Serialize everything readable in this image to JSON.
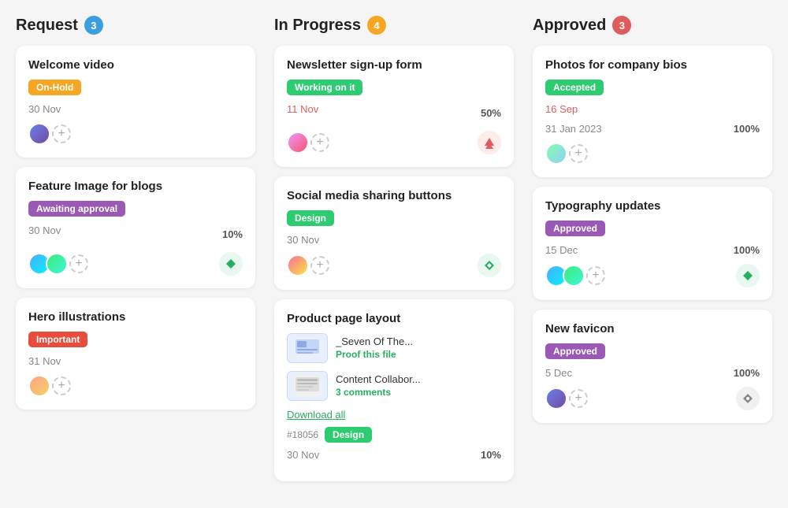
{
  "columns": [
    {
      "id": "request",
      "title": "Request",
      "badge": "3",
      "badge_class": "badge-blue",
      "cards": [
        {
          "id": "card-welcome",
          "title": "Welcome video",
          "tag": "On-Hold",
          "tag_class": "tag-on-hold",
          "date": "30 Nov",
          "date_red": false,
          "show_percent": false,
          "percent": "",
          "avatars": [
            "av1"
          ],
          "show_icon": false,
          "icon_type": ""
        },
        {
          "id": "card-feature",
          "title": "Feature Image for blogs",
          "tag": "Awaiting approval",
          "tag_class": "tag-awaiting",
          "date": "30 Nov",
          "date_red": false,
          "show_percent": true,
          "percent": "10%",
          "avatars": [
            "av3",
            "av4"
          ],
          "show_icon": true,
          "icon_type": "diamond-green"
        },
        {
          "id": "card-hero",
          "title": "Hero illustrations",
          "tag": "Important",
          "tag_class": "tag-important",
          "date": "31 Nov",
          "date_red": false,
          "show_percent": false,
          "percent": "",
          "avatars": [
            "av7"
          ],
          "show_icon": false,
          "icon_type": ""
        }
      ]
    },
    {
      "id": "in-progress",
      "title": "In Progress",
      "badge": "4",
      "badge_class": "badge-yellow",
      "cards": [
        {
          "id": "card-newsletter",
          "title": "Newsletter sign-up form",
          "tag": "Working on it",
          "tag_class": "tag-working",
          "date": "11 Nov",
          "date_red": true,
          "show_percent": true,
          "percent": "50%",
          "avatars": [
            "av2"
          ],
          "show_icon": true,
          "icon_type": "arrow-red"
        },
        {
          "id": "card-social",
          "title": "Social media sharing buttons",
          "tag": "Design",
          "tag_class": "tag-design",
          "date": "30 Nov",
          "date_red": false,
          "show_percent": false,
          "percent": "",
          "avatars": [
            "av5"
          ],
          "show_icon": true,
          "icon_type": "diamond-green"
        },
        {
          "id": "card-product",
          "title": "Product page layout",
          "tag": "",
          "tag_class": "",
          "date": "30 Nov",
          "date_red": false,
          "show_percent": true,
          "percent": "10%",
          "avatars": [
            "av6"
          ],
          "show_icon": false,
          "icon_type": "",
          "has_files": true,
          "files": [
            {
              "name": "_Seven Of The...",
              "action": "Proof this file",
              "action_color": "green"
            },
            {
              "name": "Content Collabor...",
              "action": "3 comments",
              "action_color": "green"
            }
          ],
          "download_all": "Download all",
          "hash_id": "#18056",
          "tag2": "Design",
          "tag2_class": "tag-design"
        }
      ]
    },
    {
      "id": "approved",
      "title": "Approved",
      "badge": "3",
      "badge_class": "badge-red",
      "cards": [
        {
          "id": "card-photos",
          "title": "Photos for company bios",
          "tag": "Accepted",
          "tag_class": "tag-accepted",
          "date": "16 Sep",
          "date_red": true,
          "date2": "31 Jan 2023",
          "show_percent": true,
          "percent": "100%",
          "avatars": [
            "av8"
          ],
          "show_icon": false,
          "icon_type": ""
        },
        {
          "id": "card-typography",
          "title": "Typography updates",
          "tag": "Approved",
          "tag_class": "tag-approved",
          "date": "15 Dec",
          "date_red": false,
          "show_percent": true,
          "percent": "100%",
          "avatars": [
            "av3",
            "av4"
          ],
          "show_icon": true,
          "icon_type": "diamond-green"
        },
        {
          "id": "card-favicon",
          "title": "New favicon",
          "tag": "Approved",
          "tag_class": "tag-approved",
          "date": "5 Dec",
          "date_red": false,
          "show_percent": true,
          "percent": "100%",
          "avatars": [
            "av1"
          ],
          "show_icon": true,
          "icon_type": "diamond-gray"
        }
      ]
    }
  ]
}
